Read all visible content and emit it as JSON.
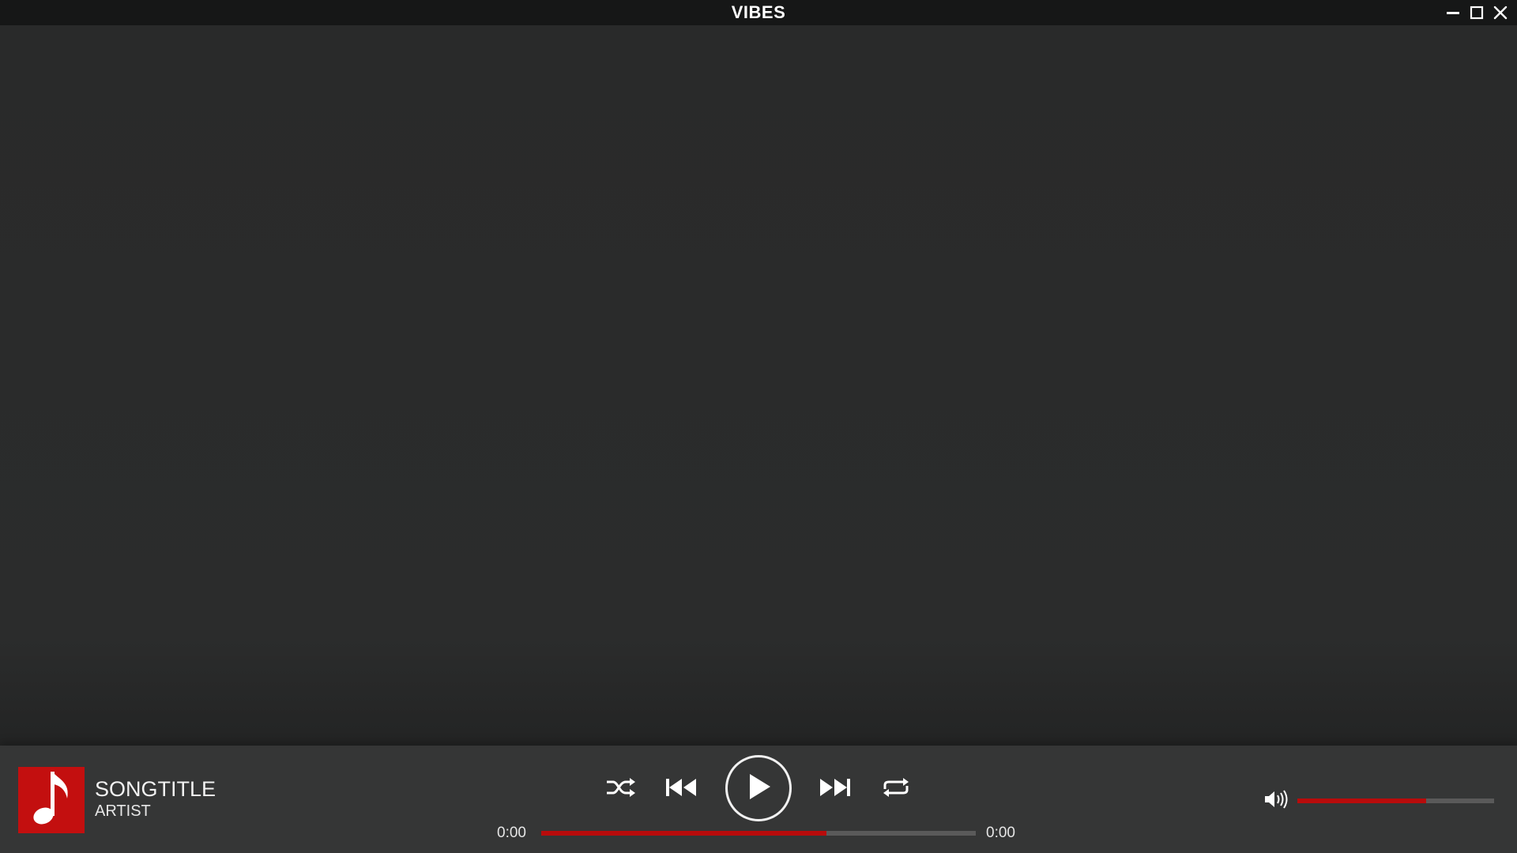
{
  "app": {
    "title": "VIBES"
  },
  "window_controls": {
    "icons": [
      "minimize-icon",
      "maximize-icon",
      "close-icon"
    ]
  },
  "now_playing": {
    "title": "SONGTITLE",
    "artist": "ARTIST",
    "album_art_icon": "music-note-icon"
  },
  "controls": {
    "icons": [
      "shuffle-icon",
      "previous-icon",
      "play-icon",
      "next-icon",
      "repeat-icon",
      "volume-icon"
    ]
  },
  "playback": {
    "current_time": "0:00",
    "total_time": "0:00",
    "progress_fraction": 0.657
  },
  "volume": {
    "level_fraction": 0.655
  },
  "colors": {
    "accent": "#b80b0b",
    "album_art_bg": "#c30f0f",
    "titlebar_bg": "#161717",
    "content_bg": "#2a2b2b",
    "player_bg": "#353636",
    "track_bg": "#5a5a5a",
    "text": "#ffffff"
  }
}
